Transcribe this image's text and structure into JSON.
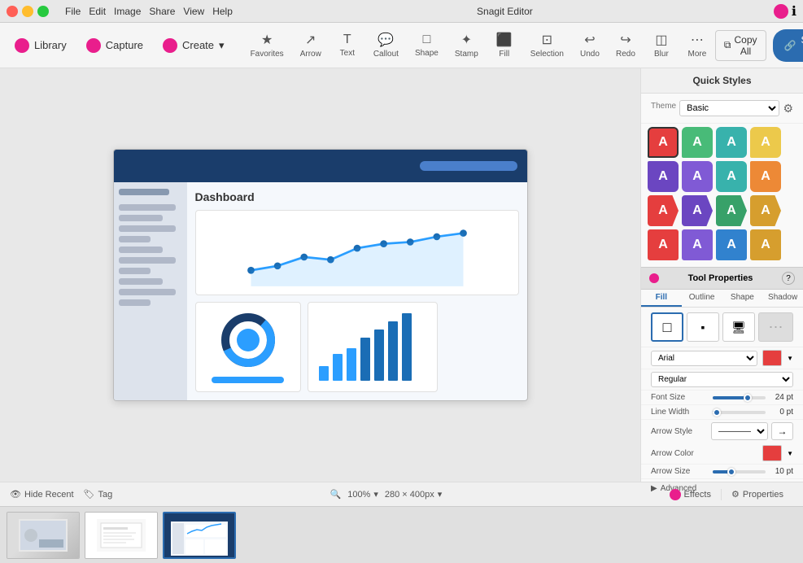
{
  "app": {
    "title": "Snagit Editor",
    "menus": [
      "File",
      "Edit",
      "Image",
      "Share",
      "View",
      "Help"
    ]
  },
  "toolbar": {
    "library_label": "Library",
    "capture_label": "Capture",
    "create_label": "Create",
    "create_arrow": "▾",
    "tools": [
      {
        "name": "favorites",
        "label": "Favorites",
        "icon": "★"
      },
      {
        "name": "arrow",
        "label": "Arrow",
        "icon": "↗"
      },
      {
        "name": "text",
        "label": "Text",
        "icon": "T"
      },
      {
        "name": "callout",
        "label": "Callout",
        "icon": "💬"
      },
      {
        "name": "shape",
        "label": "Shape",
        "icon": "□"
      },
      {
        "name": "stamp",
        "label": "Stamp",
        "icon": "✦"
      },
      {
        "name": "fill",
        "label": "Fill",
        "icon": "⬛"
      },
      {
        "name": "selection",
        "label": "Selection",
        "icon": "⊡"
      },
      {
        "name": "undo",
        "label": "Undo",
        "icon": "↩"
      },
      {
        "name": "redo",
        "label": "Redo",
        "icon": "↪"
      },
      {
        "name": "blur",
        "label": "Blur",
        "icon": "◫"
      },
      {
        "name": "more",
        "label": "More",
        "icon": "⋯"
      }
    ],
    "copy_all_label": "Copy All",
    "share_link_label": "Share Link"
  },
  "quick_styles": {
    "panel_title": "Quick Styles",
    "theme_label": "Theme",
    "theme_value": "Basic",
    "swatches": [
      {
        "color": "#e53e3e",
        "bg": "#e53e3e",
        "shape": "callout",
        "active": true
      },
      {
        "color": "#68d391",
        "bg": "#68d391",
        "shape": "callout"
      },
      {
        "color": "#48bb78",
        "bg": "#48bb78",
        "shape": "callout"
      },
      {
        "color": "#ecc94b",
        "bg": "#ecc94b",
        "shape": "callout"
      },
      {
        "color": "#9b59b6",
        "bg": "#9b59b6",
        "shape": "callout"
      },
      {
        "color": "#805ad5",
        "bg": "#805ad5",
        "shape": "callout"
      },
      {
        "color": "#38b2ac",
        "bg": "#38b2ac",
        "shape": "callout"
      },
      {
        "color": "#ed8936",
        "bg": "#ed8936",
        "shape": "callout"
      },
      {
        "color": "#e53e3e",
        "bg": "#e53e3e",
        "shape": "arrow"
      },
      {
        "color": "#6b46c1",
        "bg": "#6b46c1",
        "shape": "arrow"
      },
      {
        "color": "#38a169",
        "bg": "#38a169",
        "shape": "arrow"
      },
      {
        "color": "#d69e2e",
        "bg": "#d69e2e",
        "shape": "arrow"
      },
      {
        "color": "#e53e3e",
        "bg": "#e53e3e",
        "shape": "box"
      },
      {
        "color": "#805ad5",
        "bg": "#805ad5",
        "shape": "box"
      },
      {
        "color": "#3182ce",
        "bg": "#3182ce",
        "shape": "box"
      },
      {
        "color": "#d69e2e",
        "bg": "#d69e2e",
        "shape": "box"
      }
    ]
  },
  "tool_properties": {
    "title": "Tool Properties",
    "help_label": "?",
    "tabs": [
      "Fill",
      "Outline",
      "Shape",
      "Shadow"
    ],
    "active_tab": "Fill",
    "shapes": [
      "rect",
      "rect-shadow",
      "monitor"
    ],
    "font_label": "Arial",
    "font_style": "Regular",
    "font_size_label": "Font Size",
    "font_size_value": "24 pt",
    "line_width_label": "Line Width",
    "line_width_value": "0 pt",
    "arrow_style_label": "Arrow Style",
    "arrow_color_label": "Arrow Color",
    "arrow_size_label": "Arrow Size",
    "arrow_size_value": "10 pt",
    "advanced_label": "Advanced"
  },
  "status_bar": {
    "hide_recent_label": "Hide Recent",
    "tag_label": "Tag",
    "zoom_label": "100%",
    "size_label": "280 × 400px",
    "effects_label": "Effects",
    "properties_label": "Properties"
  },
  "dashboard": {
    "title": "Dashboard"
  },
  "thumbnails": [
    {
      "id": 1,
      "active": false
    },
    {
      "id": 2,
      "active": false
    },
    {
      "id": 3,
      "active": true
    }
  ]
}
